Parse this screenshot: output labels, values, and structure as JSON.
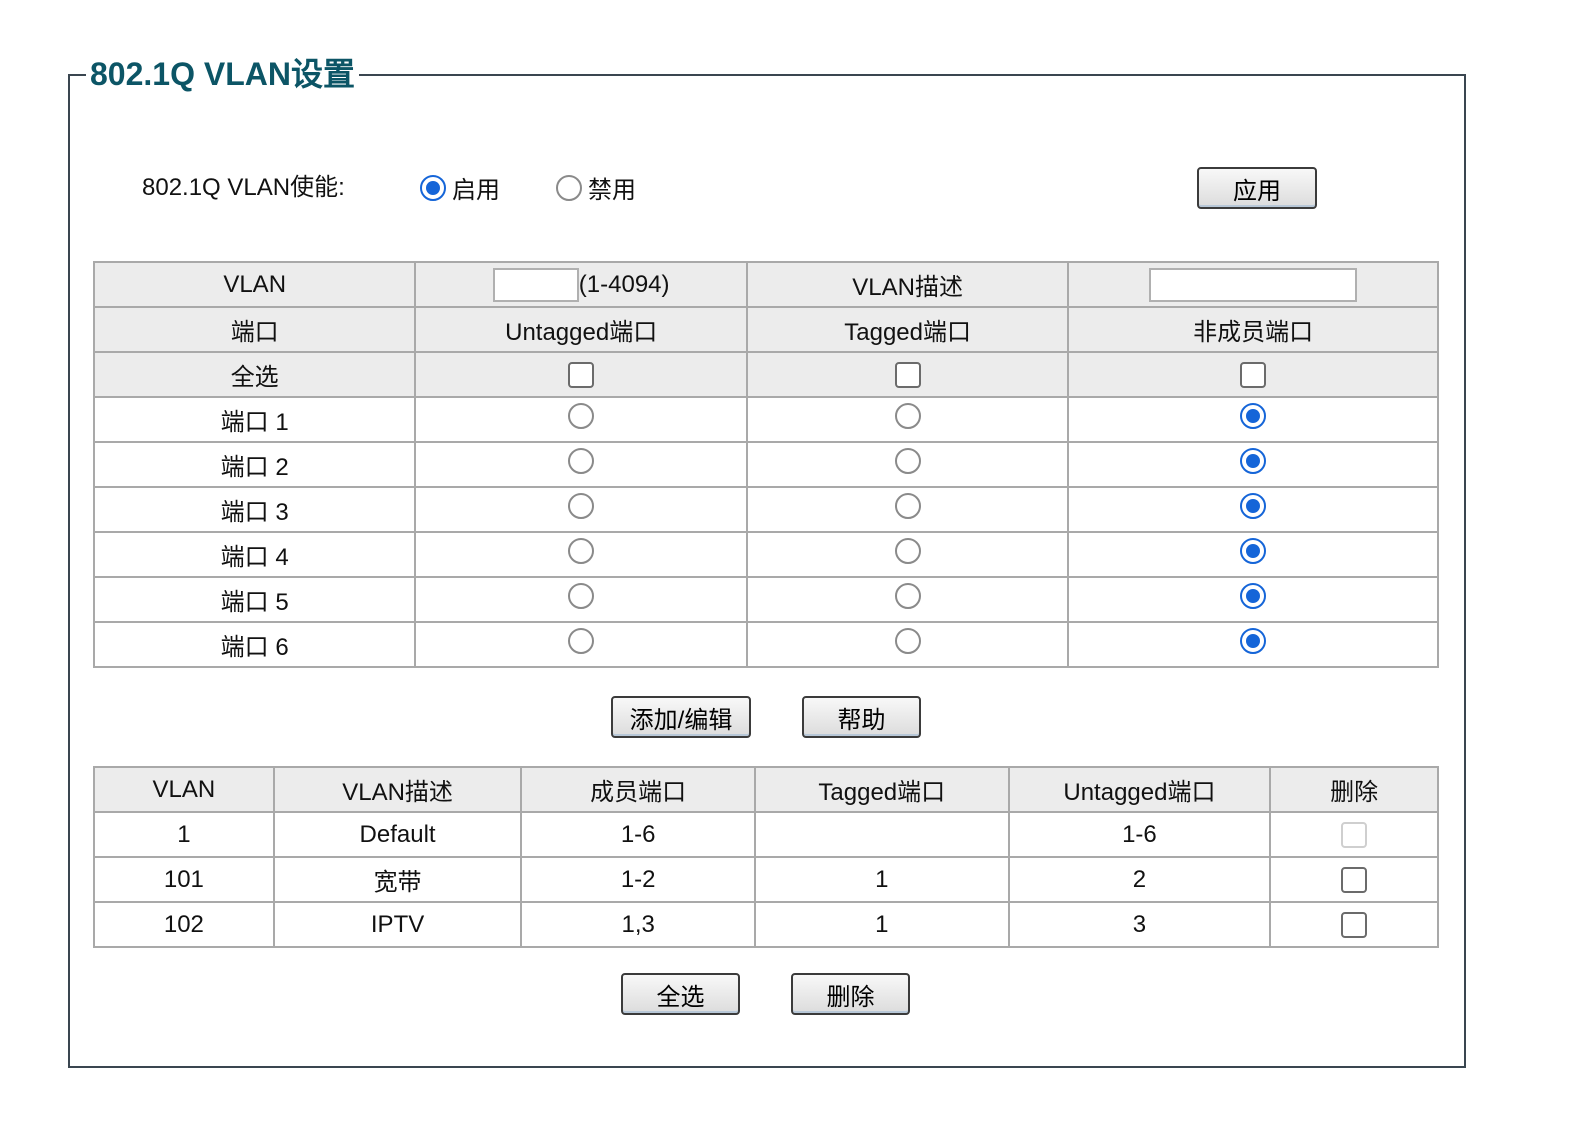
{
  "title": "802.1Q VLAN设置",
  "enable": {
    "label": "802.1Q VLAN使能:",
    "options": [
      {
        "label": "启用",
        "selected": true
      },
      {
        "label": "禁用",
        "selected": false
      }
    ],
    "apply_label": "应用"
  },
  "config": {
    "vlan_label": "VLAN",
    "vlan_range": "(1-4094)",
    "vlan_value": "",
    "desc_label": "VLAN描述",
    "desc_value": "",
    "headers": [
      "端口",
      "Untagged端口",
      "Tagged端口",
      "非成员端口"
    ],
    "select_all_label": "全选",
    "ports": [
      {
        "label": "端口 1",
        "mode": "non-member"
      },
      {
        "label": "端口 2",
        "mode": "non-member"
      },
      {
        "label": "端口 3",
        "mode": "non-member"
      },
      {
        "label": "端口 4",
        "mode": "non-member"
      },
      {
        "label": "端口 5",
        "mode": "non-member"
      },
      {
        "label": "端口 6",
        "mode": "non-member"
      }
    ],
    "add_edit_label": "添加/编辑",
    "help_label": "帮助"
  },
  "vlan_list": {
    "headers": [
      "VLAN",
      "VLAN描述",
      "成员端口",
      "Tagged端口",
      "Untagged端口",
      "删除"
    ],
    "rows": [
      {
        "vlan": "1",
        "desc": "Default",
        "members": "1-6",
        "tagged": "",
        "untagged": "1-6",
        "deletable": false
      },
      {
        "vlan": "101",
        "desc": "宽带",
        "members": "1-2",
        "tagged": "1",
        "untagged": "2",
        "deletable": true
      },
      {
        "vlan": "102",
        "desc": "IPTV",
        "members": "1,3",
        "tagged": "1",
        "untagged": "3",
        "deletable": true
      }
    ],
    "select_all_label": "全选",
    "delete_label": "删除"
  },
  "colors": {
    "accent": "#1565d8",
    "title": "#0c5566",
    "header_bg": "#ececec"
  }
}
